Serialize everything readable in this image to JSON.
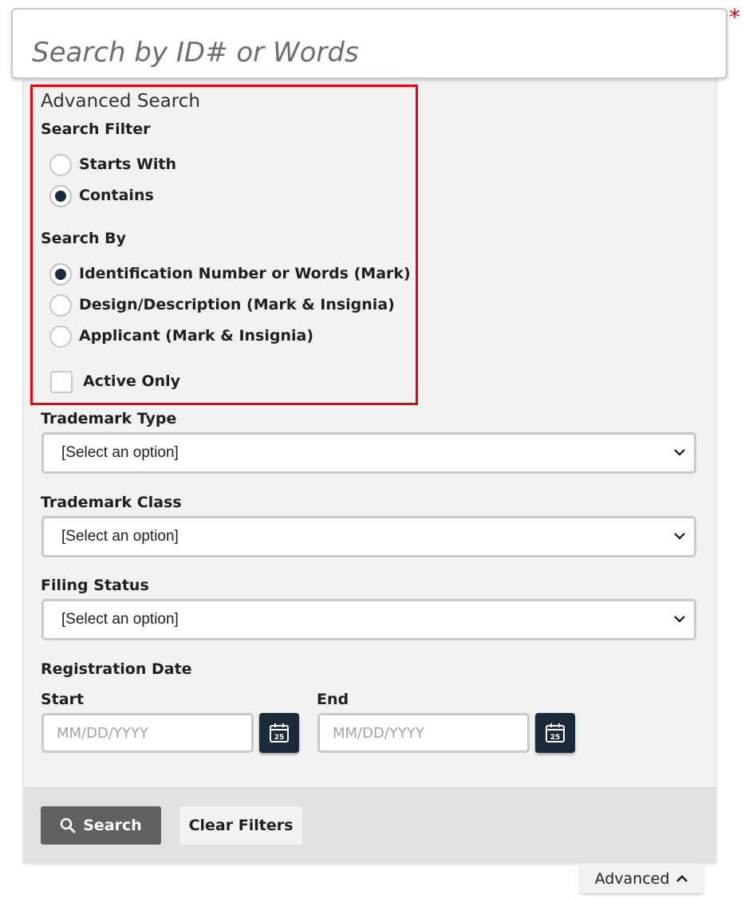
{
  "search": {
    "placeholder": "Search by ID# or Words",
    "required_marker": "*"
  },
  "advanced": {
    "title": "Advanced Search",
    "search_filter": {
      "label": "Search Filter",
      "options": [
        {
          "label": "Starts With",
          "selected": false
        },
        {
          "label": "Contains",
          "selected": true
        }
      ]
    },
    "search_by": {
      "label": "Search By",
      "options": [
        {
          "label": "Identification Number or Words (Mark)",
          "selected": true
        },
        {
          "label": "Design/Description (Mark & Insignia)",
          "selected": false
        },
        {
          "label": "Applicant (Mark & Insignia)",
          "selected": false
        }
      ]
    },
    "active_only": {
      "label": "Active Only",
      "checked": false
    }
  },
  "filters": {
    "trademark_type": {
      "label": "Trademark Type",
      "value": "[Select an option]"
    },
    "trademark_class": {
      "label": "Trademark Class",
      "value": "[Select an option]"
    },
    "filing_status": {
      "label": "Filing Status",
      "value": "[Select an option]"
    }
  },
  "registration_date": {
    "label": "Registration Date",
    "start": {
      "label": "Start",
      "placeholder": "MM/DD/YYYY"
    },
    "end": {
      "label": "End",
      "placeholder": "MM/DD/YYYY"
    },
    "calendar_day": "25"
  },
  "actions": {
    "search_label": "Search",
    "clear_label": "Clear Filters",
    "advanced_label": "Advanced"
  },
  "colors": {
    "highlight": "#e0040b",
    "navy": "#1b2a3a",
    "search_button": "#616161",
    "panel": "#f2f2f2"
  }
}
